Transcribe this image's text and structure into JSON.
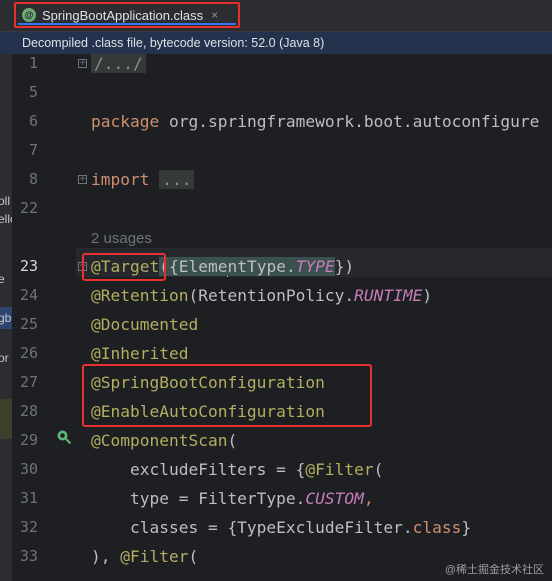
{
  "tab": {
    "icon": "spring-boot-icon",
    "icon_glyph": "@",
    "title": "SpringBootApplication.class",
    "close": "×"
  },
  "banner": "Decompiled .class file, bytecode version: 52.0 (Java 8)",
  "left_panel": [
    "oll",
    "ello",
    "e",
    "gb",
    "or"
  ],
  "gutter": {
    "lines": [
      "1",
      "5",
      "6",
      "7",
      "8",
      "22",
      "23",
      "24",
      "25",
      "26",
      "27",
      "28",
      "29",
      "30",
      "31",
      "32",
      "33"
    ],
    "current_line": "23"
  },
  "code": {
    "l1": "/.../",
    "l6_kw": "package",
    "l6_rest": " org.springframework.boot.autoconfigure",
    "l8_kw": "import",
    "l8_fold": "...",
    "usages": "2 usages",
    "l23_ann": "@Target",
    "l23_a": "({Eleme",
    "l23_b": "ntType.",
    "l23_c": "TYPE",
    "l23_d": "})",
    "l24_ann": "@Retention",
    "l24_a": "(RetentionPolicy.",
    "l24_b": "RUNTIME",
    "l24_c": ")",
    "l25": "@Documented",
    "l26": "@Inherited",
    "l27": "@SpringBootConfiguration",
    "l28": "@EnableAutoConfiguration",
    "l29_ann": "@ComponentScan",
    "l29_rest": "(",
    "l30_a": "    excludeFilters = {",
    "l30_ann": "@Filter",
    "l30_b": "(",
    "l31_a": "    type = FilterType.",
    "l31_b": "CUSTOM",
    "l31_c": ",",
    "l32_a": "    classes = {TypeExcludeFilter.",
    "l32_kw": "class",
    "l32_b": "}",
    "l33_a": "), ",
    "l33_ann": "@Filter",
    "l33_b": "("
  },
  "watermark": "@稀土掘金技术社区",
  "colors": {
    "keyword": "#cf8e6d",
    "annotation": "#b3ae60",
    "constant": "#c77dbb",
    "highlight": "#e8312f"
  }
}
